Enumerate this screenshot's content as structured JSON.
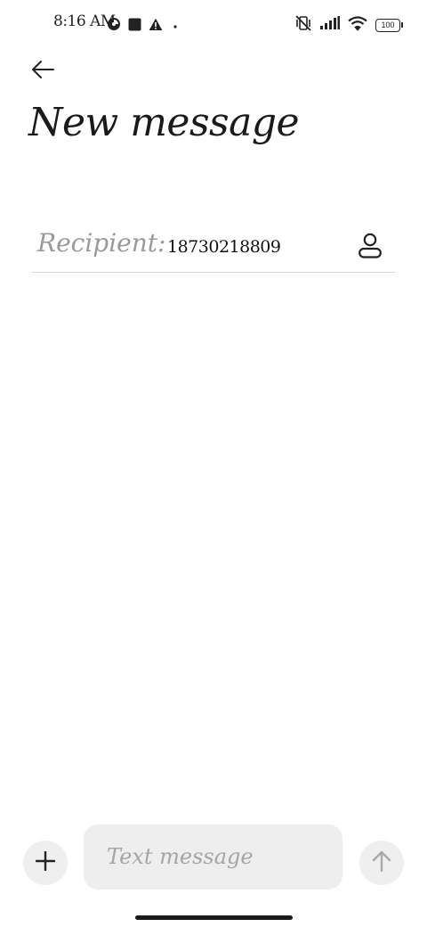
{
  "status_bar": {
    "time": "8:16 AM",
    "battery_level": "100",
    "left_icons": [
      "vpn-key-icon",
      "square-notification-icon",
      "warning-icon",
      "dot-icon"
    ],
    "right_icons": [
      "vibrate-mute-icon",
      "signal-icon",
      "wifi-icon",
      "battery-icon"
    ]
  },
  "header": {
    "back_icon": "arrow-left-icon",
    "title": "New message"
  },
  "recipient": {
    "label": "Recipient:",
    "value": "18730218809",
    "contact_icon": "person-icon"
  },
  "composer": {
    "attach_icon": "plus-icon",
    "placeholder": "Text message",
    "send_icon": "arrow-up-icon"
  },
  "colors": {
    "background": "#ffffff",
    "text": "#1a1a1a",
    "muted_text": "#9a9a9a",
    "input_background": "#eeeeee",
    "disabled_icon": "#a9a9a9"
  }
}
